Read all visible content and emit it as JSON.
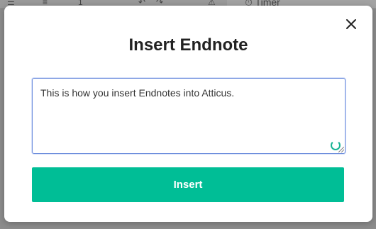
{
  "background": {
    "timer_label": "Timer",
    "toolbar_number": "1"
  },
  "modal": {
    "title": "Insert Endnote",
    "textarea_value": "This is how you insert Endnotes into Atticus.",
    "insert_label": "Insert",
    "close_icon": "close-icon"
  },
  "colors": {
    "accent": "#00be96",
    "focus_border": "#6f8fdd",
    "overlay": "#8c8c8c"
  }
}
